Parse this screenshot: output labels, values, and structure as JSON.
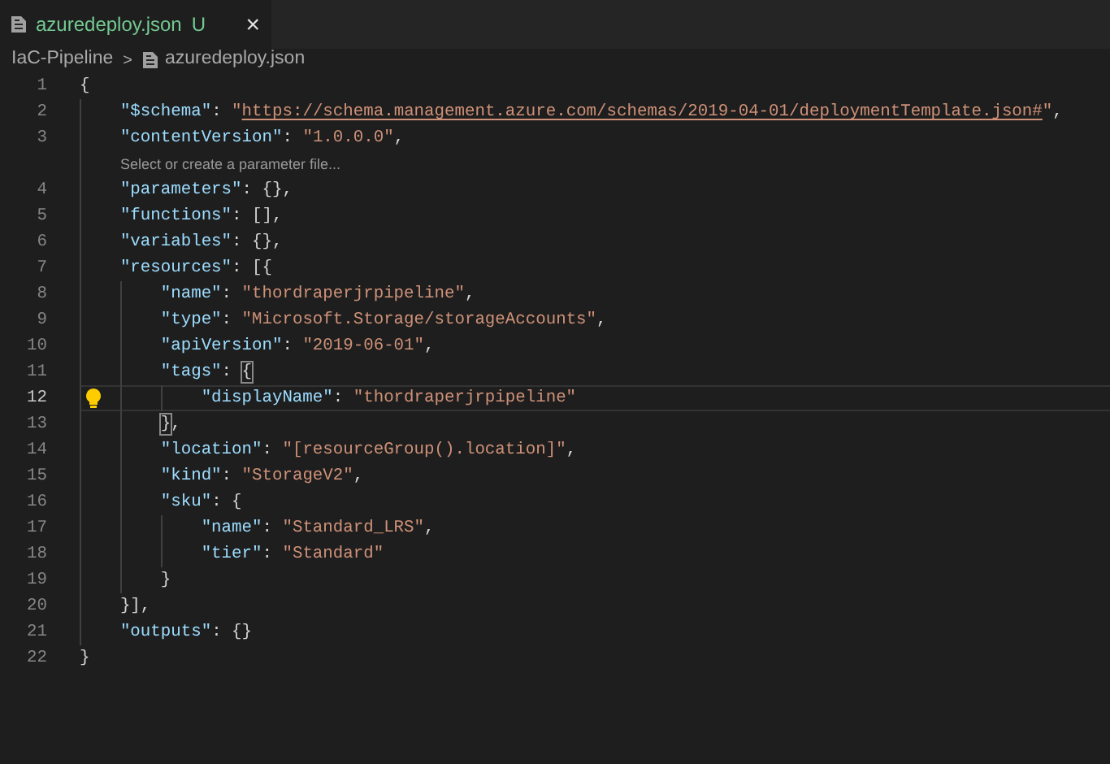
{
  "tab": {
    "label": "azuredeploy.json",
    "badge": "U",
    "close": "×",
    "selected": true
  },
  "breadcrumb": {
    "folder": "IaC-Pipeline",
    "separator": ">",
    "file": "azuredeploy.json"
  },
  "rows": [
    {
      "kind": "code",
      "number": "1",
      "current": false,
      "lightbulb": false,
      "tokens": [
        {
          "kind": "punct",
          "text": "{"
        }
      ],
      "children": [
        {
          "kind": "code",
          "number": "2",
          "current": false,
          "lightbulb": false,
          "tokens": [
            {
              "kind": "key",
              "text": "\"$schema\""
            },
            {
              "kind": "punct",
              "text": ": "
            },
            {
              "kind": "string",
              "text": "\""
            },
            {
              "kind": "link",
              "text": "https://schema.management.azure.com/schemas/2019-04-01/deploymentTemplate.json#"
            },
            {
              "kind": "string",
              "text": "\""
            },
            {
              "kind": "punct",
              "text": ","
            }
          ]
        },
        {
          "kind": "code",
          "number": "3",
          "current": false,
          "lightbulb": false,
          "tokens": [
            {
              "kind": "key",
              "text": "\"contentVersion\""
            },
            {
              "kind": "punct",
              "text": ": "
            },
            {
              "kind": "string",
              "text": "\"1.0.0.0\""
            },
            {
              "kind": "punct",
              "text": ","
            }
          ]
        },
        {
          "kind": "codelens",
          "text": "Select or create a parameter file..."
        },
        {
          "kind": "code",
          "number": "4",
          "current": false,
          "lightbulb": false,
          "tokens": [
            {
              "kind": "key",
              "text": "\"parameters\""
            },
            {
              "kind": "punct",
              "text": ": {},"
            }
          ]
        },
        {
          "kind": "code",
          "number": "5",
          "current": false,
          "lightbulb": false,
          "tokens": [
            {
              "kind": "key",
              "text": "\"functions\""
            },
            {
              "kind": "punct",
              "text": ": [],"
            }
          ]
        },
        {
          "kind": "code",
          "number": "6",
          "current": false,
          "lightbulb": false,
          "tokens": [
            {
              "kind": "key",
              "text": "\"variables\""
            },
            {
              "kind": "punct",
              "text": ": {},"
            }
          ]
        },
        {
          "kind": "code",
          "number": "7",
          "current": false,
          "lightbulb": false,
          "tokens": [
            {
              "kind": "key",
              "text": "\"resources\""
            },
            {
              "kind": "punct",
              "text": ": [{"
            }
          ],
          "children": [
            {
              "kind": "code",
              "number": "8",
              "current": false,
              "lightbulb": false,
              "tokens": [
                {
                  "kind": "key",
                  "text": "\"name\""
                },
                {
                  "kind": "punct",
                  "text": ": "
                },
                {
                  "kind": "string",
                  "text": "\"thordraperjrpipeline\""
                },
                {
                  "kind": "punct",
                  "text": ","
                }
              ]
            },
            {
              "kind": "code",
              "number": "9",
              "current": false,
              "lightbulb": false,
              "tokens": [
                {
                  "kind": "key",
                  "text": "\"type\""
                },
                {
                  "kind": "punct",
                  "text": ": "
                },
                {
                  "kind": "string",
                  "text": "\"Microsoft.Storage/storageAccounts\""
                },
                {
                  "kind": "punct",
                  "text": ","
                }
              ]
            },
            {
              "kind": "code",
              "number": "10",
              "current": false,
              "lightbulb": false,
              "tokens": [
                {
                  "kind": "key",
                  "text": "\"apiVersion\""
                },
                {
                  "kind": "punct",
                  "text": ": "
                },
                {
                  "kind": "string",
                  "text": "\"2019-06-01\""
                },
                {
                  "kind": "punct",
                  "text": ","
                }
              ]
            },
            {
              "kind": "code",
              "number": "11",
              "current": false,
              "lightbulb": false,
              "tokens": [
                {
                  "kind": "key",
                  "text": "\"tags\""
                },
                {
                  "kind": "punct",
                  "text": ": "
                },
                {
                  "kind": "match",
                  "text": "{"
                }
              ],
              "children": [
                {
                  "kind": "code",
                  "number": "12",
                  "current": true,
                  "lightbulb": true,
                  "tokens": [
                    {
                      "kind": "key",
                      "text": "\"displayName\""
                    },
                    {
                      "kind": "punct",
                      "text": ": "
                    },
                    {
                      "kind": "string",
                      "text": "\"thordraperjrpipeline\""
                    }
                  ]
                }
              ]
            },
            {
              "kind": "code",
              "number": "13",
              "current": false,
              "lightbulb": false,
              "tokens": [
                {
                  "kind": "match",
                  "text": "}"
                },
                {
                  "kind": "punct",
                  "text": ","
                }
              ]
            },
            {
              "kind": "code",
              "number": "14",
              "current": false,
              "lightbulb": false,
              "tokens": [
                {
                  "kind": "key",
                  "text": "\"location\""
                },
                {
                  "kind": "punct",
                  "text": ": "
                },
                {
                  "kind": "string",
                  "text": "\"[resourceGroup().location]\""
                },
                {
                  "kind": "punct",
                  "text": ","
                }
              ]
            },
            {
              "kind": "code",
              "number": "15",
              "current": false,
              "lightbulb": false,
              "tokens": [
                {
                  "kind": "key",
                  "text": "\"kind\""
                },
                {
                  "kind": "punct",
                  "text": ": "
                },
                {
                  "kind": "string",
                  "text": "\"StorageV2\""
                },
                {
                  "kind": "punct",
                  "text": ","
                }
              ]
            },
            {
              "kind": "code",
              "number": "16",
              "current": false,
              "lightbulb": false,
              "tokens": [
                {
                  "kind": "key",
                  "text": "\"sku\""
                },
                {
                  "kind": "punct",
                  "text": ": {"
                }
              ],
              "children": [
                {
                  "kind": "code",
                  "number": "17",
                  "current": false,
                  "lightbulb": false,
                  "tokens": [
                    {
                      "kind": "key",
                      "text": "\"name\""
                    },
                    {
                      "kind": "punct",
                      "text": ": "
                    },
                    {
                      "kind": "string",
                      "text": "\"Standard_LRS\""
                    },
                    {
                      "kind": "punct",
                      "text": ","
                    }
                  ]
                },
                {
                  "kind": "code",
                  "number": "18",
                  "current": false,
                  "lightbulb": false,
                  "tokens": [
                    {
                      "kind": "key",
                      "text": "\"tier\""
                    },
                    {
                      "kind": "punct",
                      "text": ": "
                    },
                    {
                      "kind": "string",
                      "text": "\"Standard\""
                    }
                  ]
                }
              ]
            },
            {
              "kind": "code",
              "number": "19",
              "current": false,
              "lightbulb": false,
              "tokens": [
                {
                  "kind": "punct",
                  "text": "}"
                }
              ]
            }
          ]
        },
        {
          "kind": "code",
          "number": "20",
          "current": false,
          "lightbulb": false,
          "tokens": [
            {
              "kind": "punct",
              "text": "}],"
            }
          ]
        },
        {
          "kind": "code",
          "number": "21",
          "current": false,
          "lightbulb": false,
          "tokens": [
            {
              "kind": "key",
              "text": "\"outputs\""
            },
            {
              "kind": "punct",
              "text": ": {}"
            }
          ]
        }
      ]
    },
    {
      "kind": "code",
      "number": "22",
      "current": false,
      "lightbulb": false,
      "tokens": [
        {
          "kind": "punct",
          "text": "}"
        }
      ]
    }
  ]
}
